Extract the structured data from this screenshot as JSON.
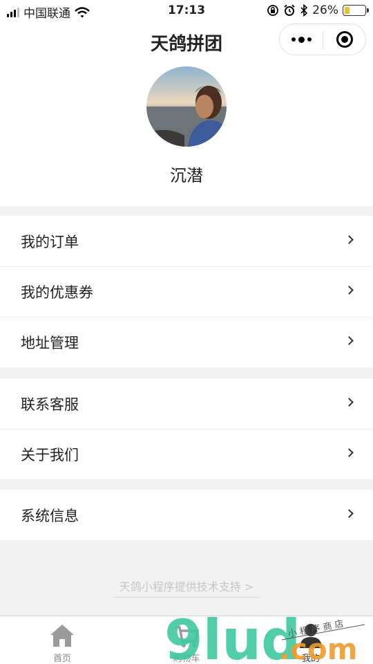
{
  "status_bar": {
    "carrier": "中国联通",
    "time": "17:13",
    "battery": "26%",
    "battery_level": 0.26
  },
  "nav": {
    "title": "天鸽拼团"
  },
  "profile": {
    "nickname": "沉潜"
  },
  "menu_groups": [
    [
      {
        "label": "我的订单"
      },
      {
        "label": "我的优惠券"
      },
      {
        "label": "地址管理"
      }
    ],
    [
      {
        "label": "联系客服"
      },
      {
        "label": "关于我们"
      }
    ],
    [
      {
        "label": "系统信息"
      }
    ]
  ],
  "footer": {
    "support_text": "天鸽小程序提供技术支持 >"
  },
  "tabs": [
    {
      "label": "首页",
      "icon": "home-icon"
    },
    {
      "label": "购物车",
      "icon": "cart-icon"
    },
    {
      "label": "我的",
      "icon": "user-icon",
      "active": true
    }
  ],
  "watermark": {
    "brand": "9lud",
    "suffix": ".com",
    "tagline": "小 程 序 商 店"
  },
  "colors": {
    "accent_watermark": "#3ec9a0",
    "orange": "#f09a2a",
    "battery": "#f2c21b"
  }
}
